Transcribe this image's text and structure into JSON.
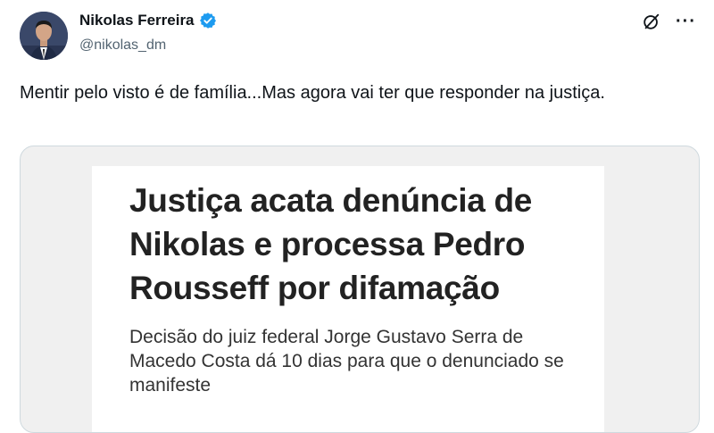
{
  "author": {
    "name": "Nikolas Ferreira",
    "handle": "@nikolas_dm",
    "verified_icon": "verified-badge-icon"
  },
  "actions": {
    "grok_icon": "grok-icon",
    "more_label": "···"
  },
  "tweet": {
    "text": "Mentir pelo visto é de família...Mas agora vai ter que responder na justiça."
  },
  "media": {
    "headline": "Justiça acata denúncia de Nikolas e processa Pedro Rousseff por difamação",
    "subhead": "Decisão do juiz federal Jorge Gustavo Serra de Macedo Costa dá 10 dias para que o denunciado se manifeste"
  },
  "colors": {
    "verified": "#1d9bf0",
    "handle_text": "#536471",
    "card_border": "#cfd9de"
  }
}
